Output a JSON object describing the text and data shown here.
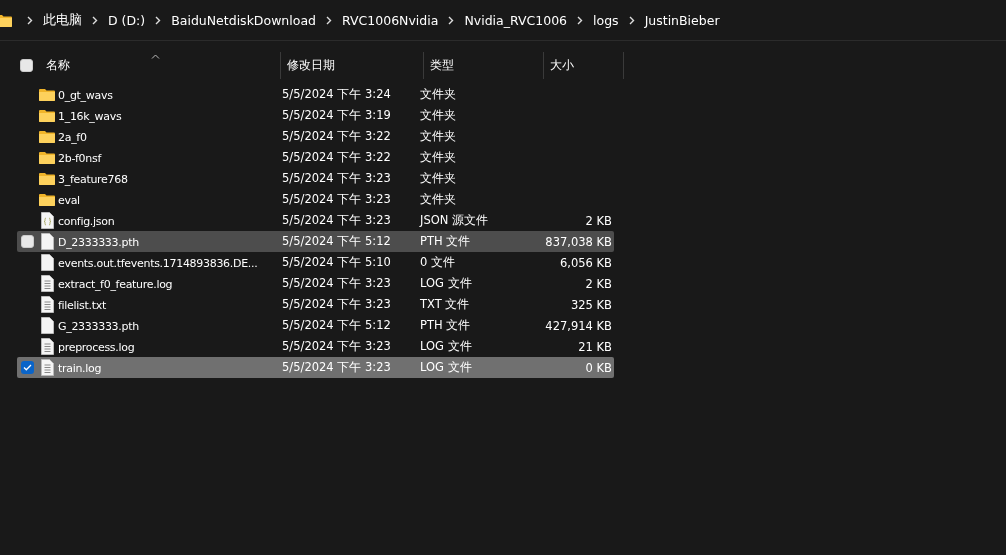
{
  "breadcrumb": [
    "此电脑",
    "D (D:)",
    "BaiduNetdiskDownload",
    "RVC1006Nvidia",
    "Nvidia_RVC1006",
    "logs",
    "JustinBieber"
  ],
  "columns": [
    "名称",
    "修改日期",
    "类型",
    "大小"
  ],
  "select_all": {
    "checked": false
  },
  "rows": [
    {
      "kind": "folder",
      "name": "0_gt_wavs",
      "date": "5/5/2024 下午 3:24",
      "type": "文件夹",
      "size": "",
      "selected": false,
      "hovered": false
    },
    {
      "kind": "folder",
      "name": "1_16k_wavs",
      "date": "5/5/2024 下午 3:19",
      "type": "文件夹",
      "size": "",
      "selected": false,
      "hovered": false
    },
    {
      "kind": "folder",
      "name": "2a_f0",
      "date": "5/5/2024 下午 3:22",
      "type": "文件夹",
      "size": "",
      "selected": false,
      "hovered": false
    },
    {
      "kind": "folder",
      "name": "2b-f0nsf",
      "date": "5/5/2024 下午 3:22",
      "type": "文件夹",
      "size": "",
      "selected": false,
      "hovered": false
    },
    {
      "kind": "folder",
      "name": "3_feature768",
      "date": "5/5/2024 下午 3:23",
      "type": "文件夹",
      "size": "",
      "selected": false,
      "hovered": false
    },
    {
      "kind": "folder",
      "name": "eval",
      "date": "5/5/2024 下午 3:23",
      "type": "文件夹",
      "size": "",
      "selected": false,
      "hovered": false
    },
    {
      "kind": "json",
      "name": "config.json",
      "date": "5/5/2024 下午 3:23",
      "type": "JSON 源文件",
      "size": "2 KB",
      "selected": false,
      "hovered": false
    },
    {
      "kind": "file",
      "name": "D_2333333.pth",
      "date": "5/5/2024 下午 5:12",
      "type": "PTH 文件",
      "size": "837,038 KB",
      "selected": false,
      "hovered": true
    },
    {
      "kind": "file",
      "name": "events.out.tfevents.1714893836.DE...",
      "date": "5/5/2024 下午 5:10",
      "type": "0 文件",
      "size": "6,056 KB",
      "selected": false,
      "hovered": false
    },
    {
      "kind": "text",
      "name": "extract_f0_feature.log",
      "date": "5/5/2024 下午 3:23",
      "type": "LOG 文件",
      "size": "2 KB",
      "selected": false,
      "hovered": false
    },
    {
      "kind": "text",
      "name": "filelist.txt",
      "date": "5/5/2024 下午 3:23",
      "type": "TXT 文件",
      "size": "325 KB",
      "selected": false,
      "hovered": false
    },
    {
      "kind": "file",
      "name": "G_2333333.pth",
      "date": "5/5/2024 下午 5:12",
      "type": "PTH 文件",
      "size": "427,914 KB",
      "selected": false,
      "hovered": false
    },
    {
      "kind": "text",
      "name": "preprocess.log",
      "date": "5/5/2024 下午 3:23",
      "type": "LOG 文件",
      "size": "21 KB",
      "selected": false,
      "hovered": false
    },
    {
      "kind": "text",
      "name": "train.log",
      "date": "5/5/2024 下午 3:23",
      "type": "LOG 文件",
      "size": "0 KB",
      "selected": true,
      "hovered": false
    }
  ]
}
